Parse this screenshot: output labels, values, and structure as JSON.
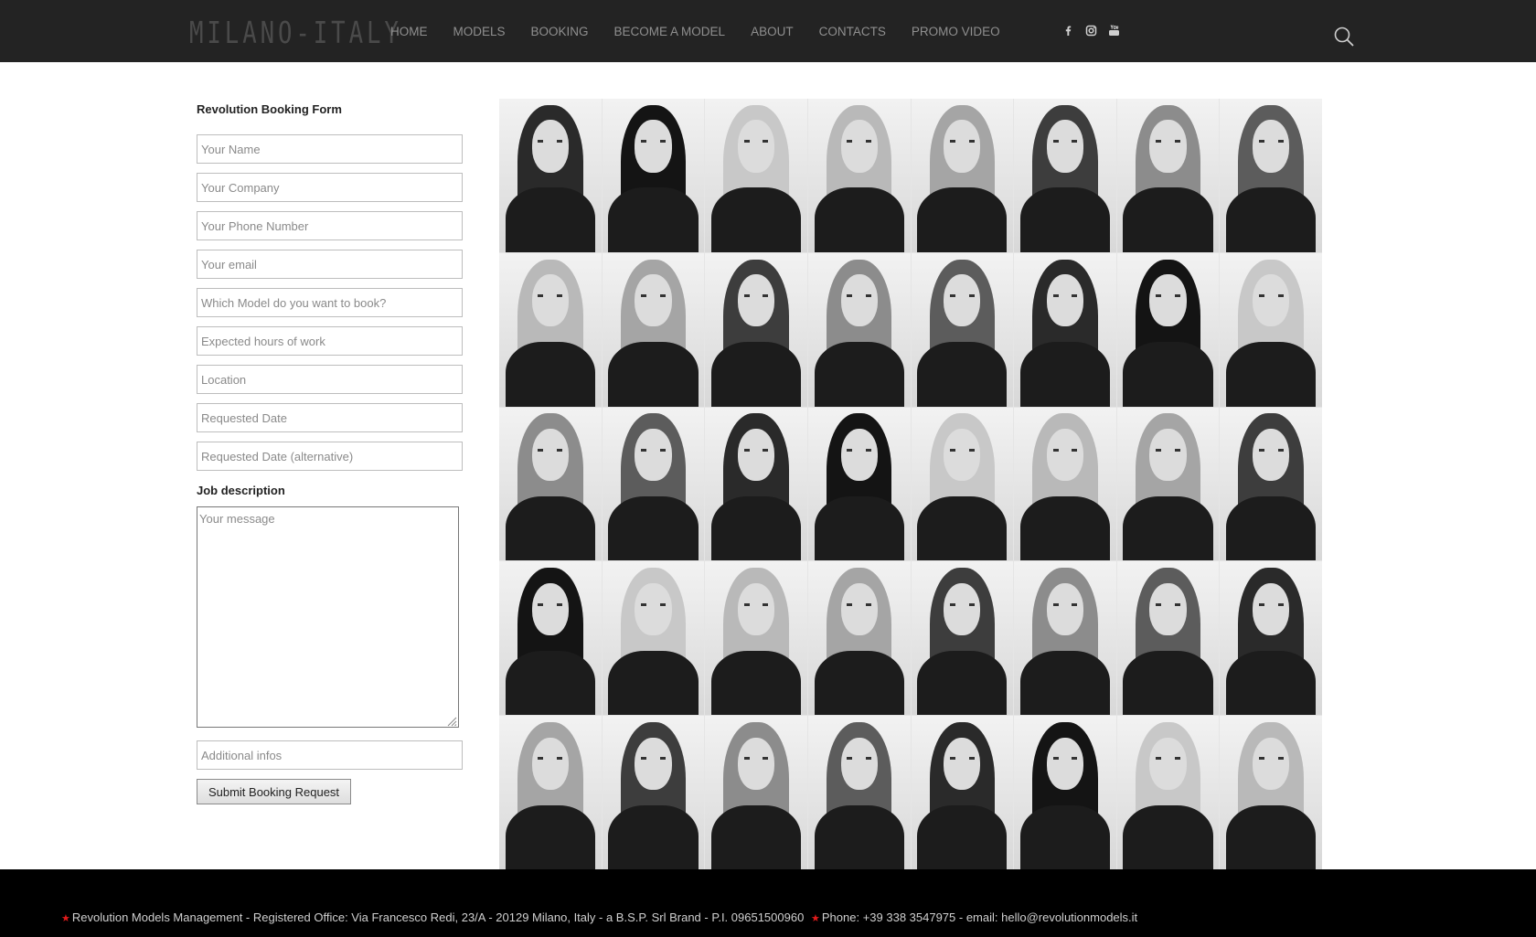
{
  "header": {
    "logo_text": "MILANO-ITALY",
    "nav": [
      "HOME",
      "MODELS",
      "BOOKING",
      "BECOME A MODEL",
      "ABOUT",
      "CONTACTS",
      "PROMO VIDEO"
    ],
    "social_icons": [
      "facebook-icon",
      "instagram-icon",
      "youtube-icon"
    ]
  },
  "form": {
    "title": "Revolution Booking Form",
    "fields": [
      {
        "placeholder": "Your Name",
        "value": ""
      },
      {
        "placeholder": "Your Company",
        "value": ""
      },
      {
        "placeholder": "Your Phone Number",
        "value": ""
      },
      {
        "placeholder": "Your email",
        "value": ""
      },
      {
        "placeholder": "Which Model do you want to book?",
        "value": ""
      },
      {
        "placeholder": "Expected hours of work",
        "value": ""
      },
      {
        "placeholder": "Location",
        "value": ""
      },
      {
        "placeholder": "Requested Date",
        "value": ""
      },
      {
        "placeholder": "Requested Date (alternative)",
        "value": ""
      }
    ],
    "job_label": "Job description",
    "message_placeholder": "Your message",
    "additional_placeholder": "Additional infos",
    "submit_label": "Submit Booking Request"
  },
  "gallery": {
    "rows": 5,
    "columns": 8,
    "photo_count": 40
  },
  "footer": {
    "left": "Revolution Models Management - Registered Office: Via Francesco Redi, 23/A - 20129 Milano, Italy - a B.S.P. Srl Brand - P.I. 09651500960",
    "right": "Phone: +39 338 3547975 - email: hello@revolutionmodels.it",
    "bullet": "★"
  },
  "colors": {
    "header_bg": "#232323",
    "footer_bg": "#000000",
    "nav_text": "#8f8f8f",
    "accent_star": "#e31b1b"
  }
}
